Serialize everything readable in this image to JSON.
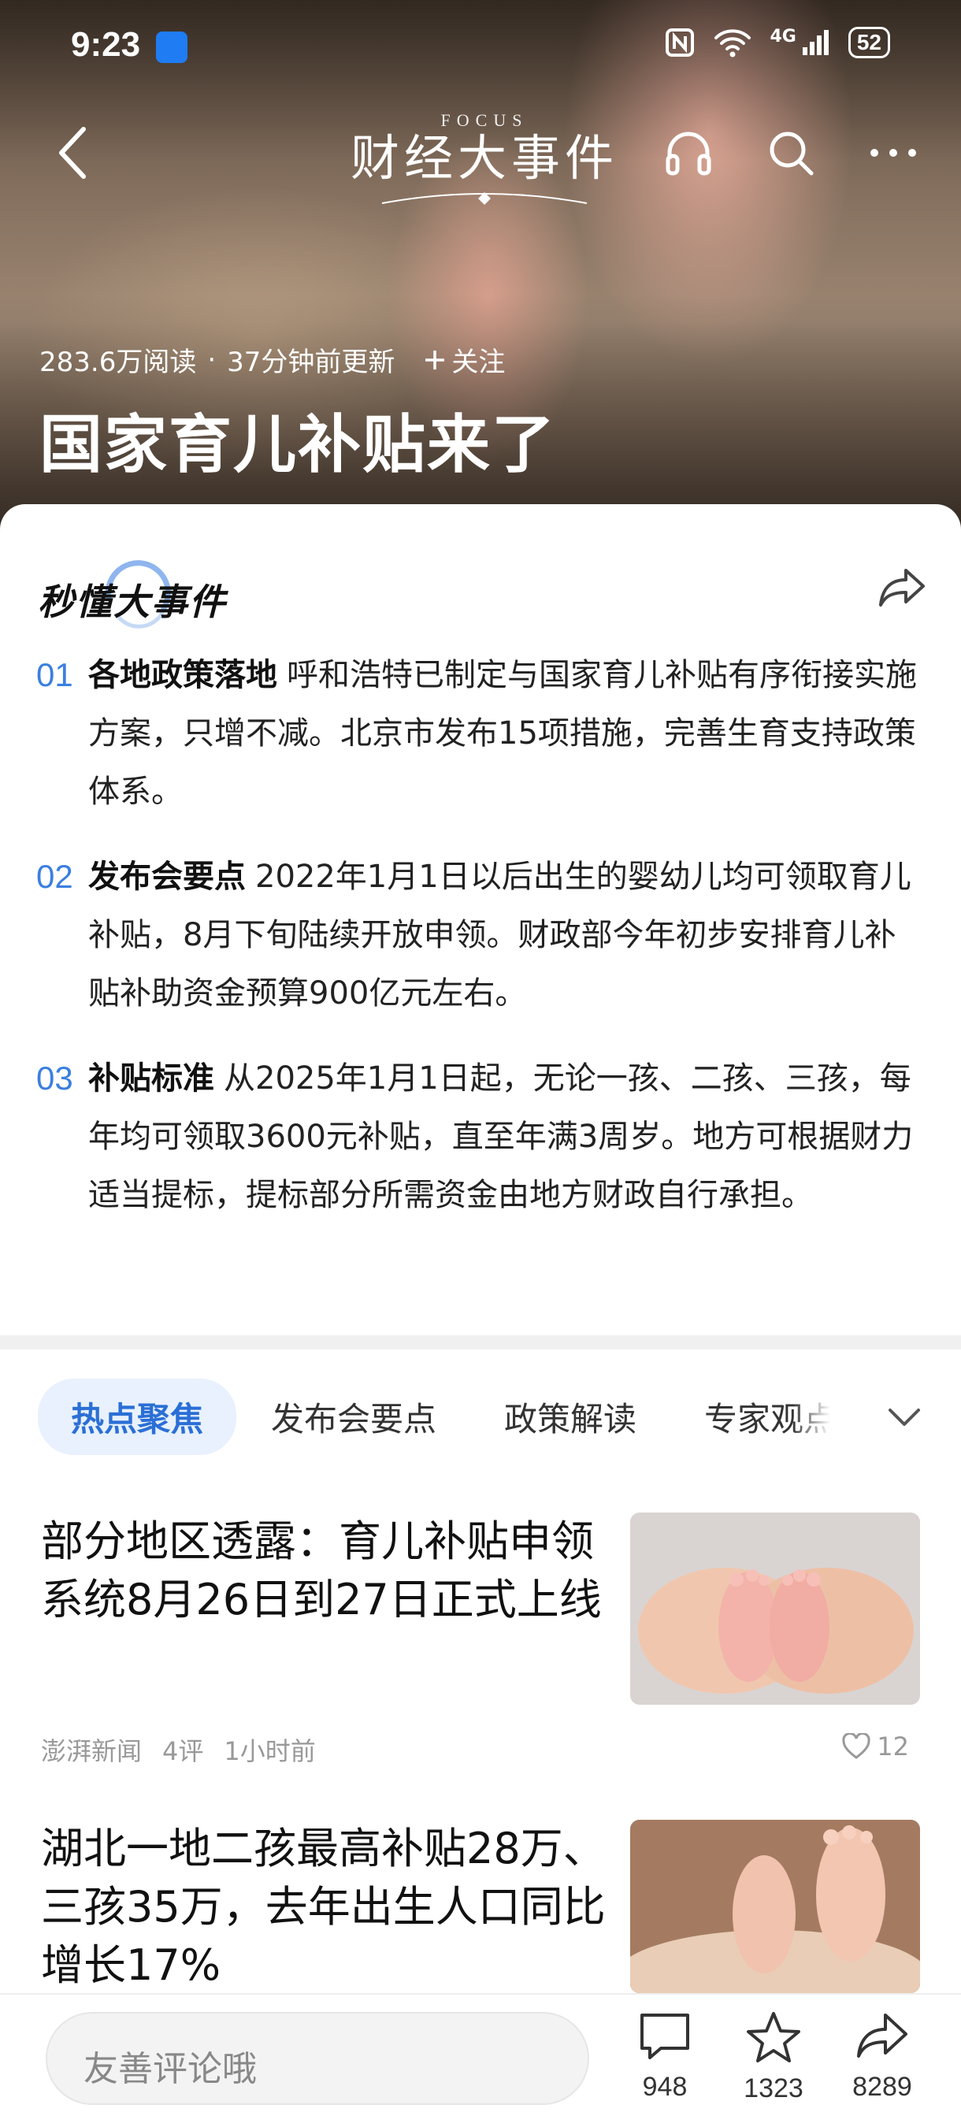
{
  "status_bar": {
    "time": "9:23",
    "network": "4G",
    "battery": "52"
  },
  "nav": {
    "brand_small": "FOCUS",
    "brand_title": "财经大事件"
  },
  "hero": {
    "reads": "283.6万阅读",
    "updated": "37分钟前更新",
    "follow_label": "关注",
    "title": "国家育儿补贴来了"
  },
  "summary": {
    "logo_text": "秒懂大事件",
    "points": [
      {
        "num": "01",
        "head": "各地政策落地",
        "body": "呼和浩特已制定与国家育儿补贴有序衔接实施方案，只增不减。北京市发布15项措施，完善生育支持政策体系。"
      },
      {
        "num": "02",
        "head": "发布会要点",
        "body": "2022年1月1日以后出生的婴幼儿均可领取育儿补贴，8月下旬陆续开放申领。财政部今年初步安排育儿补贴补助资金预算900亿元左右。"
      },
      {
        "num": "03",
        "head": "补贴标准",
        "body": "从2025年1月1日起，无论一孩、二孩、三孩，每年均可领取3600元补贴，直至年满3周岁。地方可根据财力适当提标，提标部分所需资金由地方财政自行承担。"
      }
    ]
  },
  "tabs": [
    "热点聚焦",
    "发布会要点",
    "政策解读",
    "专家观点"
  ],
  "feed": [
    {
      "title": "部分地区透露：育儿补贴申领系统8月26日到27日正式上线",
      "source": "澎湃新闻",
      "comments": "4评",
      "time": "1小时前",
      "likes": "12"
    },
    {
      "title": "湖北一地二孩最高补贴28万、三孩35万，去年出生人口同比增长17%"
    }
  ],
  "bottom_bar": {
    "comment_placeholder": "友善评论哦",
    "comments_count": "948",
    "favorites_count": "1323",
    "shares_count": "8289"
  }
}
